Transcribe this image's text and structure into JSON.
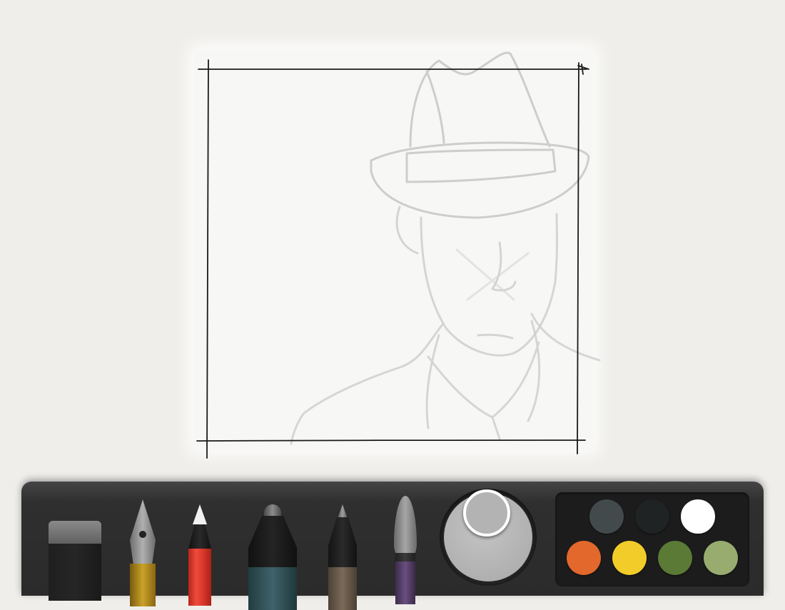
{
  "app": {
    "tools": [
      {
        "id": "eraser",
        "name": "eraser"
      },
      {
        "id": "pen",
        "name": "fountain-pen",
        "color": "#caa22a"
      },
      {
        "id": "pencil",
        "name": "pencil",
        "color": "#ef4b3c",
        "selected": true
      },
      {
        "id": "marker",
        "name": "marker",
        "color": "#3e636a"
      },
      {
        "id": "finepen",
        "name": "fine-pen",
        "color": "#7a6a58"
      },
      {
        "id": "brush",
        "name": "brush",
        "color": "#6a4e80"
      }
    ],
    "color_mixer": {
      "current_color": "#b3b3b3"
    },
    "palette": [
      {
        "color": "#424a4c"
      },
      {
        "color": "#1f2324"
      },
      {
        "color": "#ffffff"
      },
      {
        "color": "#e2682c"
      },
      {
        "color": "#f2cd2a"
      },
      {
        "color": "#5a7a35"
      },
      {
        "color": "#98ac70"
      }
    ]
  }
}
